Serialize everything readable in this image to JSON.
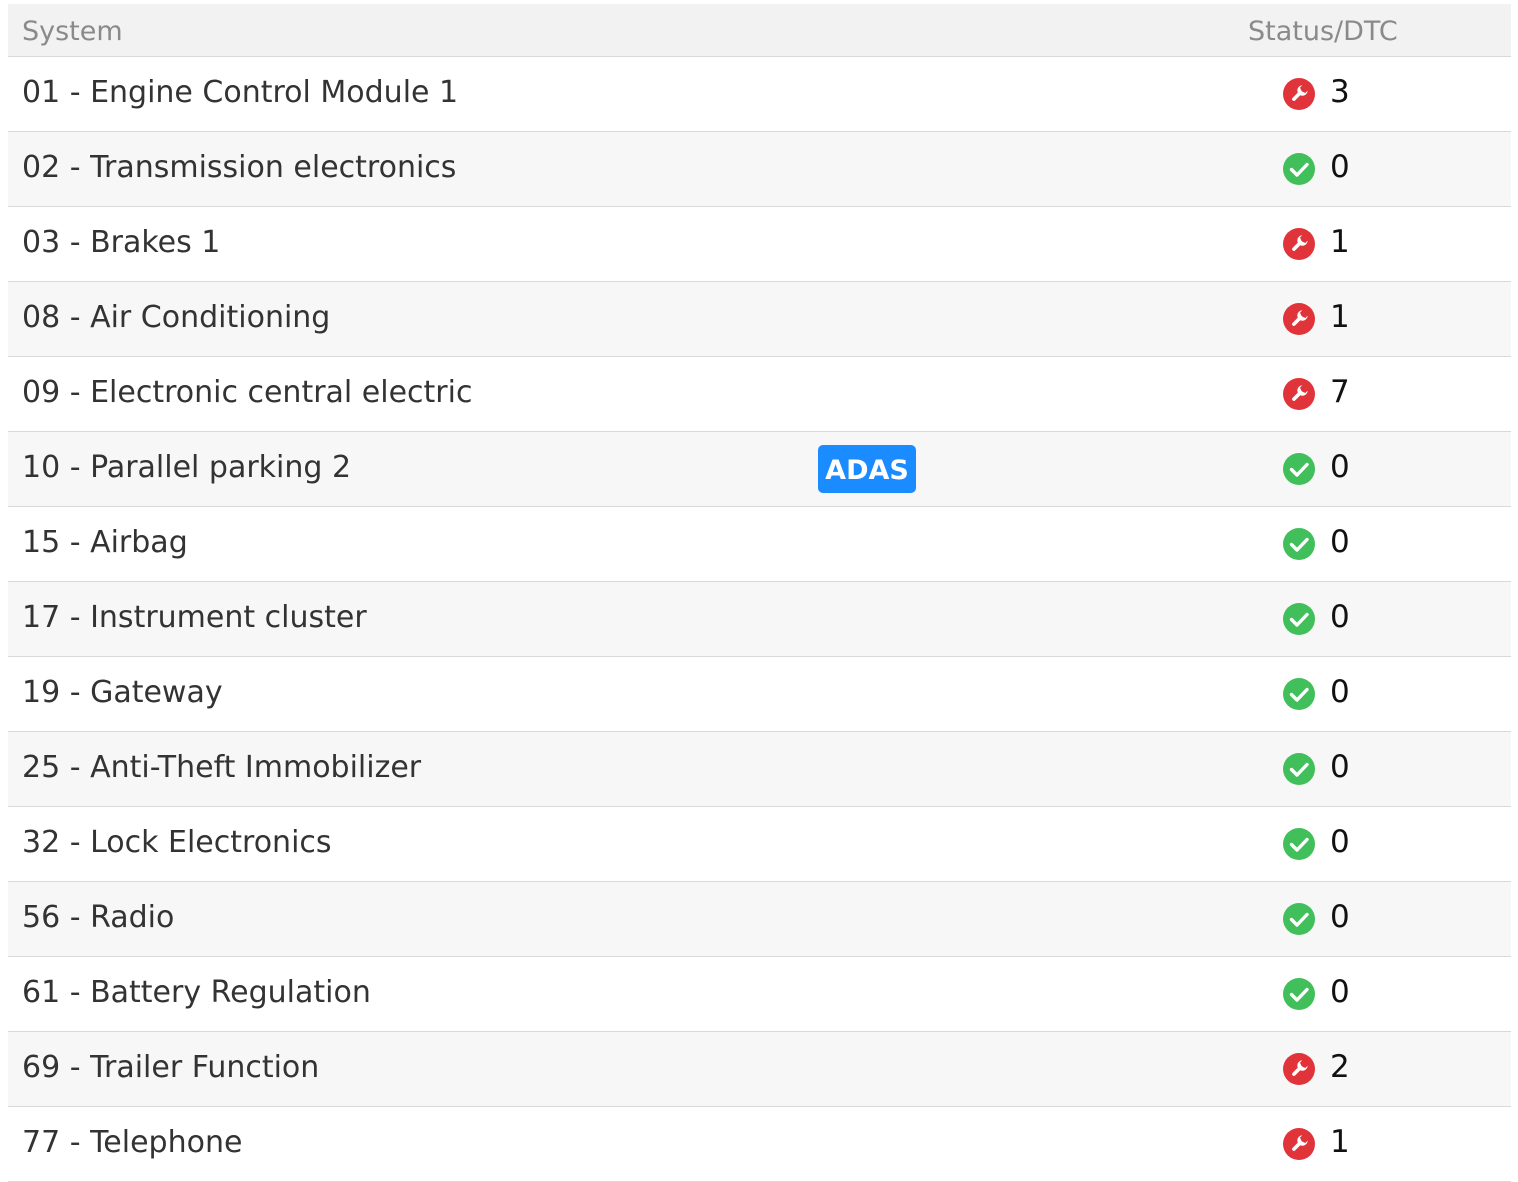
{
  "header": {
    "system": "System",
    "status": "Status/DTC"
  },
  "colors": {
    "error": "#e0333a",
    "ok": "#41bf5a",
    "adas": "#1a8cff"
  },
  "adas_label": "ADAS",
  "rows": [
    {
      "name": "01 - Engine Control Module 1",
      "status": "error",
      "count": "3"
    },
    {
      "name": "02 - Transmission electronics",
      "status": "ok",
      "count": "0"
    },
    {
      "name": "03 - Brakes 1",
      "status": "error",
      "count": "1"
    },
    {
      "name": "08 - Air Conditioning",
      "status": "error",
      "count": "1"
    },
    {
      "name": "09 - Electronic central electric",
      "status": "error",
      "count": "7"
    },
    {
      "name": "10 - Parallel parking 2",
      "status": "ok",
      "count": "0",
      "badge": "ADAS"
    },
    {
      "name": "15 - Airbag",
      "status": "ok",
      "count": "0"
    },
    {
      "name": "17 - Instrument cluster",
      "status": "ok",
      "count": "0"
    },
    {
      "name": "19 - Gateway",
      "status": "ok",
      "count": "0"
    },
    {
      "name": "25 - Anti-Theft Immobilizer",
      "status": "ok",
      "count": "0"
    },
    {
      "name": "32 - Lock Electronics",
      "status": "ok",
      "count": "0"
    },
    {
      "name": "56 - Radio",
      "status": "ok",
      "count": "0"
    },
    {
      "name": "61 - Battery Regulation",
      "status": "ok",
      "count": "0"
    },
    {
      "name": "69 - Trailer Function",
      "status": "error",
      "count": "2"
    },
    {
      "name": "77 - Telephone",
      "status": "error",
      "count": "1"
    }
  ]
}
